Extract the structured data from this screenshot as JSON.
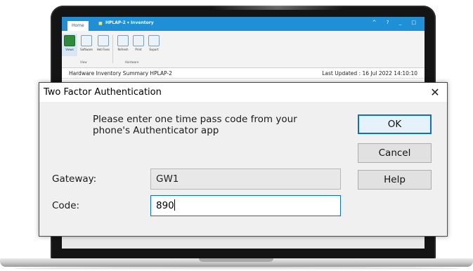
{
  "background_app": {
    "tab_home": "Home",
    "window_title": "HPLAP-2 ▾  Inventory",
    "window_controls": "^ ? _ □",
    "ribbon": {
      "buttons": [
        "Views",
        "Software",
        "Hot Fixes",
        "Refresh",
        "Print",
        "Export"
      ],
      "groups": [
        "View",
        "Hardware"
      ]
    },
    "summary_title": "Hardware Inventory Summary HPLAP-2",
    "last_updated": "Last Updated : 16 Jul 2022 14:10:10"
  },
  "dialog": {
    "title": "Two Factor Authentication",
    "close_glyph": "✕",
    "message_line1": "Please enter one time pass code from your",
    "message_line2": "phone's Authenticator app",
    "gateway_label": "Gateway:",
    "gateway_value": "GW1",
    "code_label": "Code:",
    "code_value": "890",
    "ok_label": "OK",
    "cancel_label": "Cancel",
    "help_label": "Help"
  },
  "colors": {
    "accent": "#0a6fd3",
    "app_titlebar": "#1f8fd6",
    "dialog_bg": "#f0f0f0"
  }
}
